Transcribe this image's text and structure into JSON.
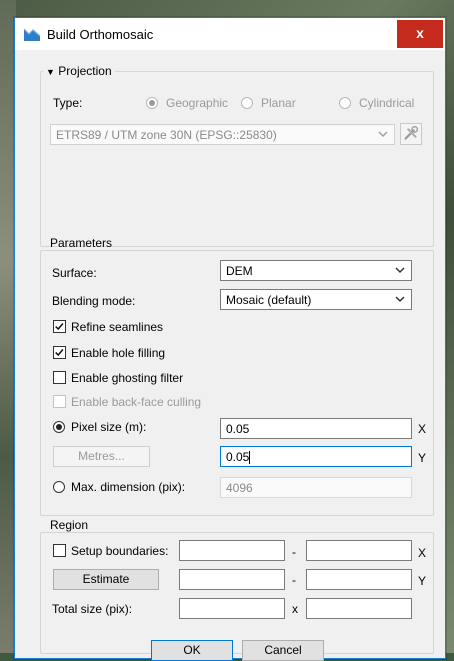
{
  "window": {
    "title": "Build Orthomosaic",
    "close_glyph": "x"
  },
  "projection": {
    "legend": "Projection",
    "type_label": "Type:",
    "options": [
      "Geographic",
      "Planar",
      "Cylindrical"
    ],
    "selected": "Geographic",
    "crs_value": "ETRS89 / UTM zone 30N (EPSG::25830)"
  },
  "parameters": {
    "legend": "Parameters",
    "surface_label": "Surface:",
    "surface_value": "DEM",
    "blending_label": "Blending mode:",
    "blending_value": "Mosaic (default)",
    "checkboxes": [
      {
        "label": "Refine seamlines",
        "checked": true,
        "enabled": true
      },
      {
        "label": "Enable hole filling",
        "checked": true,
        "enabled": true
      },
      {
        "label": "Enable ghosting filter",
        "checked": false,
        "enabled": true
      },
      {
        "label": "Enable back-face culling",
        "checked": false,
        "enabled": false
      }
    ],
    "pixel_size_label": "Pixel size (m):",
    "pixel_x": "0.05",
    "pixel_y": "0.05",
    "x_axis": "X",
    "y_axis": "Y",
    "metres_button": "Metres...",
    "max_dim_label": "Max. dimension (pix):",
    "max_dim_value": "4096"
  },
  "region": {
    "legend": "Region",
    "setup_label": "Setup boundaries:",
    "estimate_button": "Estimate",
    "total_label": "Total size (pix):",
    "dash": "-",
    "times": "x",
    "x_axis": "X",
    "y_axis": "Y"
  },
  "footer": {
    "ok": "OK",
    "cancel": "Cancel"
  },
  "colors": {
    "accent": "#0078d7",
    "close": "#c42b1c",
    "title_border": "#1a7fd0"
  }
}
